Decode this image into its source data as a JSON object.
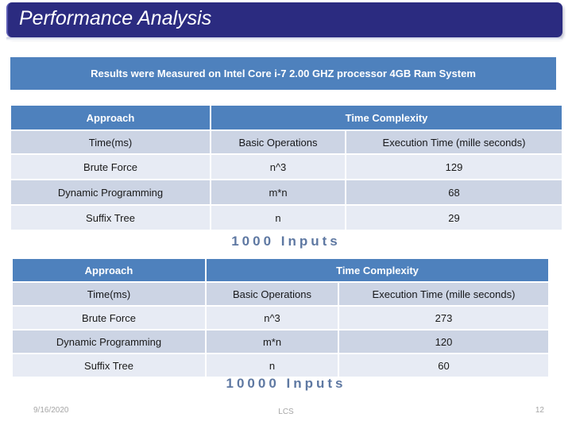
{
  "slide": {
    "title": "Performance Analysis",
    "banner": "Results were Measured on  Intel Core i-7 2.00 GHZ processor  4GB Ram System",
    "accent_blue": "#4E81BD",
    "title_navy": "#2B2B80",
    "row_light": "#E7EBF4",
    "row_dark": "#CCD4E4",
    "caption_color": "#436192"
  },
  "tables": [
    {
      "caption": "1000 Inputs",
      "header_main": [
        "Approach",
        "Time Complexity"
      ],
      "header_sub": [
        "Time(ms)",
        "Basic Operations",
        "Execution Time (mille seconds)"
      ],
      "rows": [
        [
          "Brute Force",
          "n^3",
          "129"
        ],
        [
          "Dynamic Programming",
          "m*n",
          "68"
        ],
        [
          "Suffix Tree",
          "n",
          "29"
        ]
      ]
    },
    {
      "caption": "10000 Inputs",
      "header_main": [
        "Approach",
        "Time Complexity"
      ],
      "header_sub": [
        "Time(ms)",
        "Basic Operations",
        "Execution Time (mille seconds)"
      ],
      "rows": [
        [
          "Brute Force",
          "n^3",
          "273"
        ],
        [
          "Dynamic Programming",
          "m*n",
          "120"
        ],
        [
          "Suffix Tree",
          "n",
          "60"
        ]
      ]
    }
  ],
  "footer": {
    "date": "9/16/2020",
    "center": "LCS",
    "page": "12"
  }
}
